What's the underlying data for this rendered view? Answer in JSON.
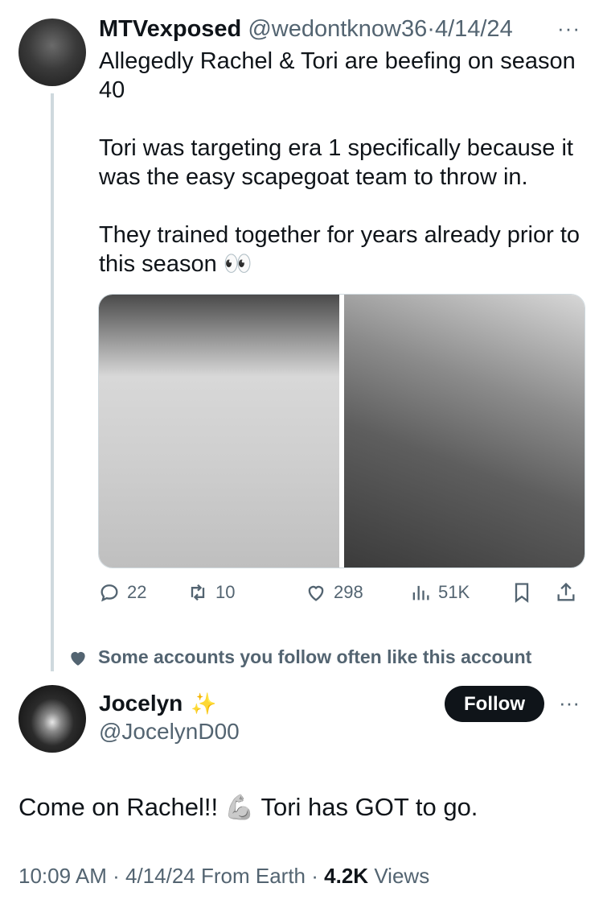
{
  "tweet": {
    "display_name": "MTVexposed",
    "handle": "@wedontknow36",
    "separator": "·",
    "date": "4/14/24",
    "more_icon": "ellipsis-icon",
    "paragraphs": [
      "Allegedly Rachel & Tori are beefing on season 40",
      "Tori was targeting era 1 specifically because it was the easy scapegoat team to throw in.",
      "They trained together for years already prior to this season 👀"
    ],
    "actions": {
      "reply_count": "22",
      "retweet_count": "10",
      "like_count": "298",
      "views_count": "51K"
    }
  },
  "social_context": {
    "icon": "heart-icon",
    "text": "Some accounts you follow often like this account"
  },
  "reply": {
    "display_name": "Jocelyn",
    "badge": "✨",
    "handle": "@JocelynD00",
    "follow_label": "Follow",
    "text_before": "Come on Rachel!!",
    "emoji": "💪",
    "text_after": "Tori has GOT to go.",
    "time": "10:09 AM",
    "separator": "·",
    "date": "4/14/24",
    "location": "From Earth",
    "views_value": "4.2K",
    "views_label": "Views"
  },
  "colors": {
    "text_primary": "#0f1419",
    "text_secondary": "#536471",
    "thread_line": "#cfd9de",
    "button_bg": "#0f1419"
  }
}
